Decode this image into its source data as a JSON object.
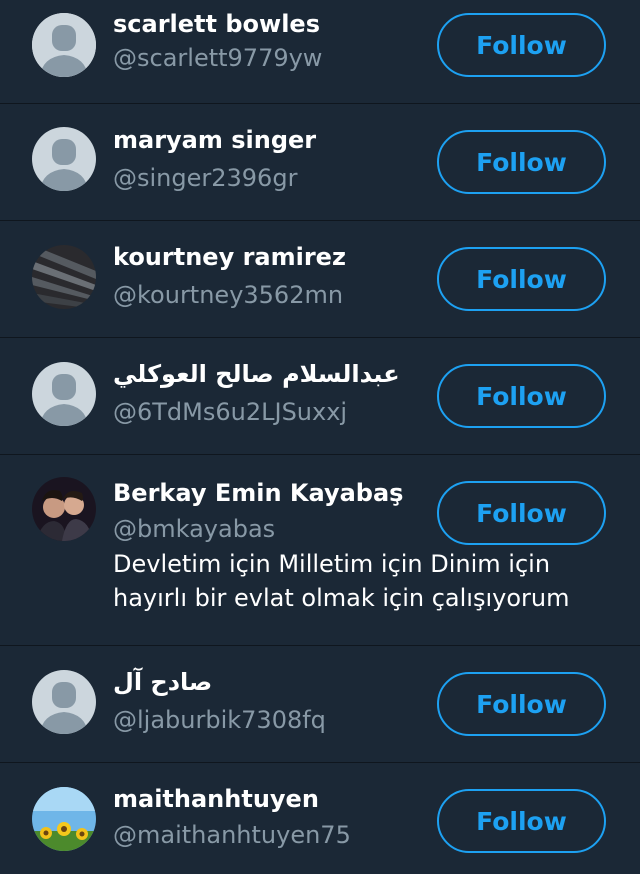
{
  "colors": {
    "background": "#1b2836",
    "divider": "#0f161e",
    "accent": "#1da1f2",
    "name": "#ffffff",
    "handle": "#8899a6"
  },
  "users": [
    {
      "name": "scarlett bowles",
      "handle": "@scarlett9779yw",
      "avatar": "default-avatar-icon",
      "follow_label": "Follow"
    },
    {
      "name": "maryam singer",
      "handle": "@singer2396gr",
      "avatar": "default-avatar-icon",
      "follow_label": "Follow"
    },
    {
      "name": "kourtney ramirez",
      "handle": "@kourtney3562mn",
      "avatar": "striped-avatar-icon",
      "follow_label": "Follow"
    },
    {
      "name": "عبدالسلام صالح العوكلي",
      "handle": "@6TdMs6u2LJSuxxj",
      "avatar": "default-avatar-icon",
      "follow_label": "Follow"
    },
    {
      "name": "Berkay Emin Kayabaş",
      "handle": "@bmkayabas",
      "avatar": "photo-avatar-icon",
      "follow_label": "Follow",
      "bio_line1": "Devletim için Milletim için Dinim için",
      "bio_line2": "hayırlı bir evlat olmak için çalışıyorum"
    },
    {
      "name": "صادح آل",
      "handle": "@ljaburbik7308fq",
      "avatar": "default-avatar-icon",
      "follow_label": "Follow"
    },
    {
      "name": "maithanhtuyen",
      "handle": "@maithanhtuyen75",
      "avatar": "sunflower-avatar-icon",
      "follow_label": "Follow"
    }
  ]
}
